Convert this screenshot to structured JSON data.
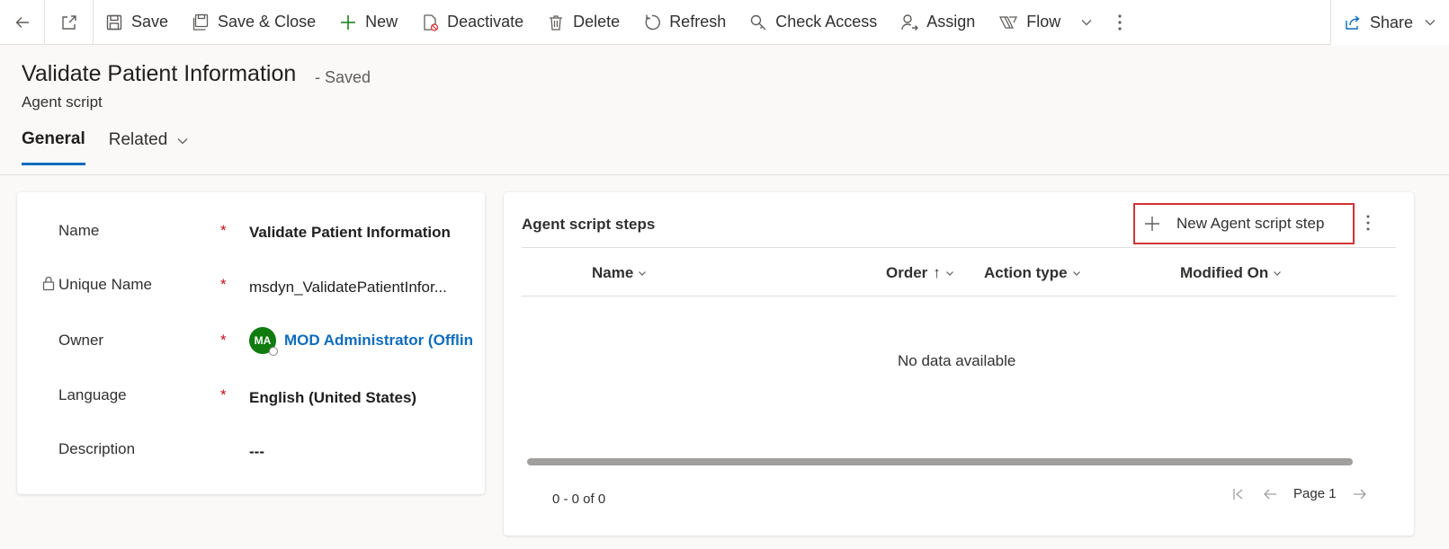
{
  "commandbar": {
    "save": "Save",
    "save_close": "Save & Close",
    "new": "New",
    "deactivate": "Deactivate",
    "delete": "Delete",
    "refresh": "Refresh",
    "check_access": "Check Access",
    "assign": "Assign",
    "flow": "Flow",
    "share": "Share"
  },
  "header": {
    "title": "Validate Patient Information",
    "saved_status": "- Saved",
    "entity": "Agent script"
  },
  "tabs": [
    {
      "label": "General"
    },
    {
      "label": "Related"
    }
  ],
  "form": {
    "name_label": "Name",
    "name_value": "Validate Patient Information",
    "unique_name_label": "Unique Name",
    "unique_name_value": "msdyn_ValidatePatientInfor...",
    "owner_label": "Owner",
    "owner_initials": "MA",
    "owner_value": "MOD Administrator (Offlin",
    "language_label": "Language",
    "language_value": "English (United States)",
    "description_label": "Description",
    "description_value": "---",
    "required_marker": "*"
  },
  "grid": {
    "title": "Agent script steps",
    "new_button": "New Agent script step",
    "columns": [
      "Name",
      "Order",
      "Action type",
      "Modified On"
    ],
    "sort_indicator": "↑",
    "empty_message": "No data available",
    "record_count": "0 - 0 of 0",
    "page_label": "Page 1"
  },
  "colors": {
    "accent": "#0f6cbd",
    "required": "#c50f1f",
    "highlight_border": "#d13438",
    "avatar": "#107c10"
  }
}
